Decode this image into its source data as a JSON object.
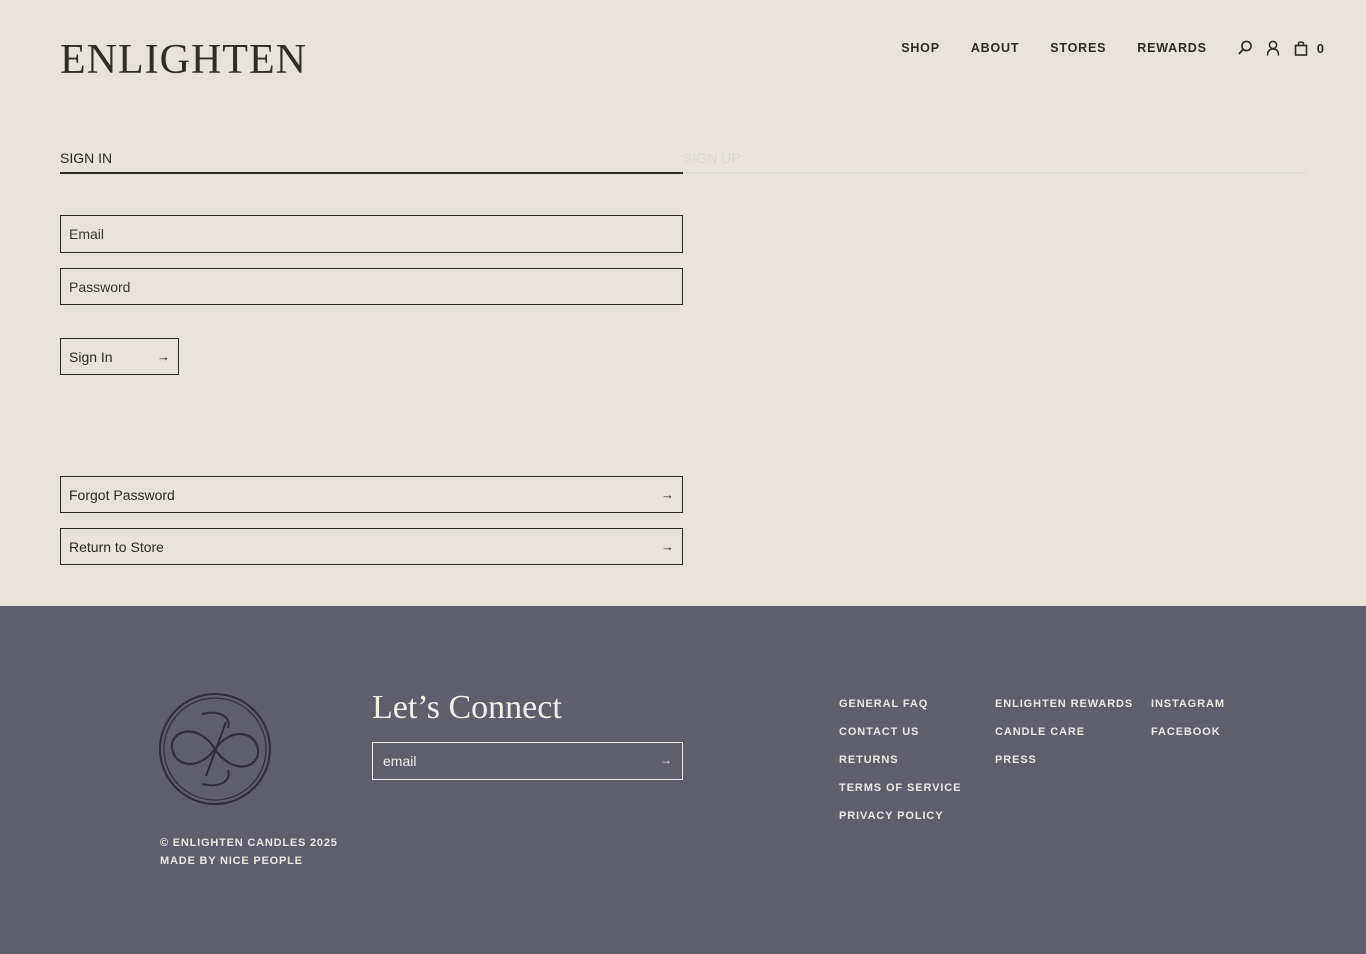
{
  "header": {
    "logo": "ENLIGHTEN",
    "nav": [
      {
        "label": "SHOP"
      },
      {
        "label": "ABOUT"
      },
      {
        "label": "STORES"
      },
      {
        "label": "REWARDS"
      }
    ],
    "icons": [
      "search-icon",
      "account-icon",
      "cart-icon"
    ],
    "cart_count": "0"
  },
  "tabs": {
    "signin": "SIGN IN",
    "signup": "SIGN UP"
  },
  "form": {
    "email_placeholder": "Email",
    "password_placeholder": "Password",
    "signin_button": "Sign In",
    "forgot_password": "Forgot Password",
    "return_to_store": "Return to Store",
    "arrow": "→"
  },
  "footer": {
    "copyright_line1": "© ENLIGHTEN CANDLES 2025",
    "copyright_line2": "MADE BY NICE PEOPLE",
    "connect_title": "Let’s Connect",
    "newsletter_placeholder": "email",
    "links_col1": [
      "GENERAL FAQ",
      "CONTACT US",
      "RETURNS",
      "TERMS OF SERVICE",
      "PRIVACY POLICY"
    ],
    "links_col2": [
      "ENLIGHTEN REWARDS",
      "CANDLE CARE",
      "PRESS"
    ],
    "links_col3": [
      "INSTAGRAM",
      "FACEBOOK"
    ]
  },
  "colors": {
    "background": "#e7e3dc",
    "footer": "#5f5e6d",
    "text": "#2b2a28"
  }
}
